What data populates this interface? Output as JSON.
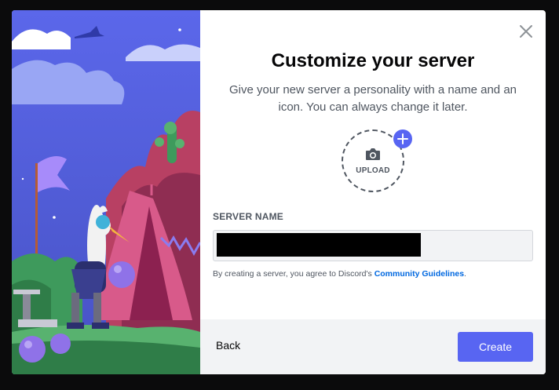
{
  "modal": {
    "title": "Customize your server",
    "subtitle": "Give your new server a personality with a name and an icon. You can always change it later.",
    "close_icon": "close-icon"
  },
  "upload": {
    "label": "UPLOAD",
    "icon": "camera-icon",
    "badge_icon": "plus-icon"
  },
  "server_name": {
    "label": "SERVER NAME",
    "value": "",
    "redacted": true
  },
  "terms": {
    "prefix": "By creating a server, you agree to Discord's ",
    "link_text": "Community Guidelines",
    "suffix": "."
  },
  "footer": {
    "back_label": "Back",
    "create_label": "Create"
  },
  "colors": {
    "brand": "#5865f2",
    "link": "#0068e0",
    "footer_bg": "#f2f3f5"
  }
}
